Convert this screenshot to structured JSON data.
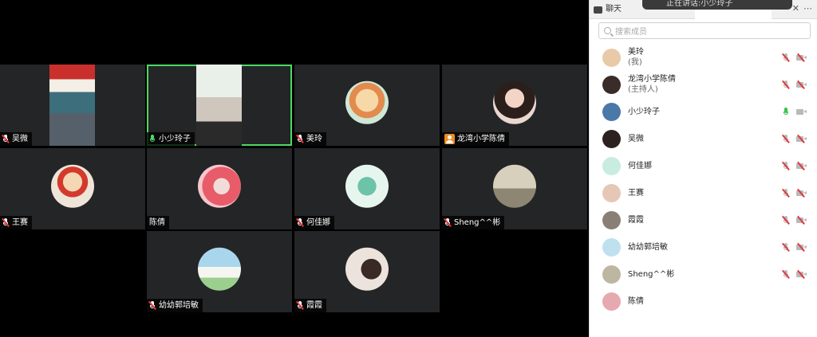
{
  "panel": {
    "tab_chat": "聊天",
    "toast_text": "正在讲话:小少玲子",
    "search_placeholder": "搜索成员"
  },
  "tiles": [
    {
      "name": "吴微",
      "mic": "muted"
    },
    {
      "name": "小少玲子",
      "mic": "on",
      "active": true
    },
    {
      "name": "美玲",
      "mic": "muted"
    },
    {
      "name": "龙湾小学陈倩",
      "mic": "host"
    },
    {
      "name": "王赛",
      "mic": "muted"
    },
    {
      "name": "陈倩",
      "mic": "none"
    },
    {
      "name": "何佳娜",
      "mic": "muted"
    },
    {
      "name": "Sheng^^彬",
      "mic": "muted"
    },
    {
      "name": "幼幼郭培敏",
      "mic": "muted"
    },
    {
      "name": "霞霞",
      "mic": "muted"
    }
  ],
  "members": [
    {
      "name": "美玲",
      "sub": "(我)",
      "mic": "muted",
      "cam": "muted",
      "color": "#e8c9a8"
    },
    {
      "name": "龙湾小学陈倩",
      "sub": "(主持人)",
      "mic": "muted",
      "cam": "muted",
      "color": "#3a2c28"
    },
    {
      "name": "小少玲子",
      "sub": "",
      "mic": "on",
      "cam": "neutral",
      "color": "#4a78a8"
    },
    {
      "name": "吴微",
      "sub": "",
      "mic": "muted",
      "cam": "muted",
      "color": "#2b2220"
    },
    {
      "name": "何佳娜",
      "sub": "",
      "mic": "muted",
      "cam": "muted",
      "color": "#c8ece0"
    },
    {
      "name": "王赛",
      "sub": "",
      "mic": "muted",
      "cam": "muted",
      "color": "#e6c7b5"
    },
    {
      "name": "霞霞",
      "sub": "",
      "mic": "muted",
      "cam": "muted",
      "color": "#8a7f77"
    },
    {
      "name": "幼幼郭培敏",
      "sub": "",
      "mic": "muted",
      "cam": "muted",
      "color": "#bfe0ef"
    },
    {
      "name": "Sheng^^彬",
      "sub": "",
      "mic": "muted",
      "cam": "muted",
      "color": "#bdb6a0"
    },
    {
      "name": "陈倩",
      "sub": "",
      "mic": "none",
      "cam": "none",
      "color": "#e7a9b0"
    }
  ]
}
